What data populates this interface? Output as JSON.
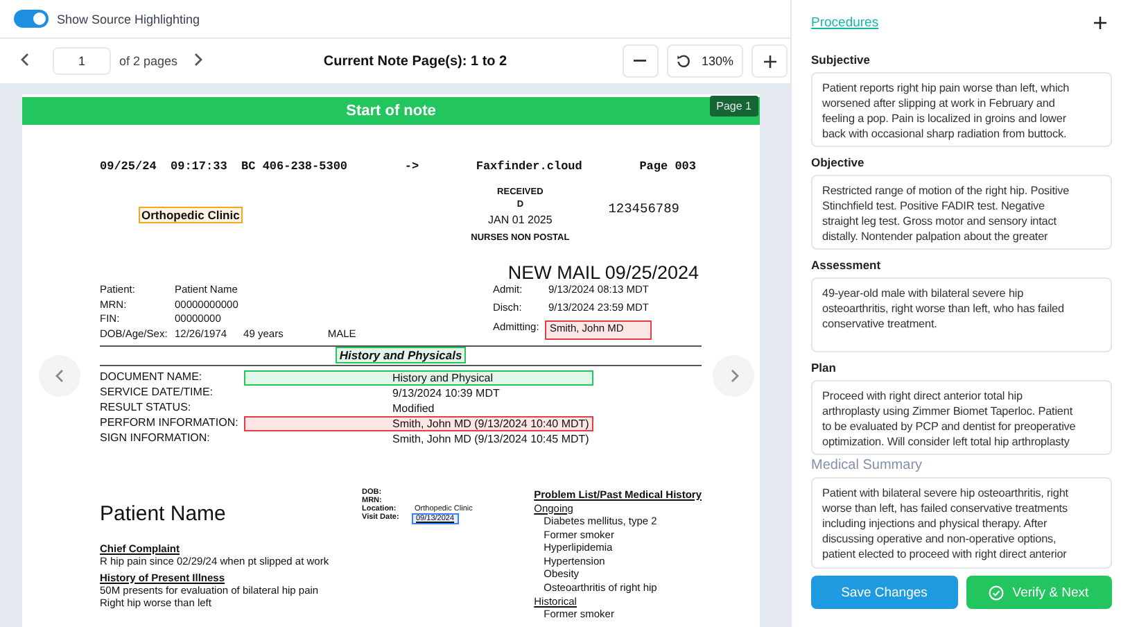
{
  "highlight_toggle": {
    "label": "Show Source Highlighting",
    "on": true
  },
  "toolbar": {
    "page_input": "1",
    "page_count": "of 2 pages",
    "title": "Current Note Page(s): 1 to 2",
    "zoom": "130%"
  },
  "document": {
    "banner": "Start of note",
    "page_badge": "Page 1",
    "fax_header": [
      "09/25/24  09:17:33  BC 406-238-5300",
      "->",
      "Faxfinder.cloud",
      "Page 003"
    ],
    "clinic": {
      "text": "Orthopedic Clinic",
      "color": "#f5a623"
    },
    "stamp": [
      "RECEIVED",
      "D",
      "JAN 01 2025",
      "NURSES NON POSTAL"
    ],
    "stamp_number": "123456789",
    "mail_title": "NEW MAIL 09/25/2024",
    "patient_fields": [
      {
        "label": "Patient:",
        "values": [
          "Patient Name"
        ]
      },
      {
        "label": "MRN:",
        "values": [
          "00000000000"
        ]
      },
      {
        "label": "FIN:",
        "values": [
          "00000000"
        ]
      },
      {
        "label": "DOB/Age/Sex:",
        "values": [
          "12/26/1974",
          "49 years",
          "MALE"
        ]
      }
    ],
    "admission_fields": [
      {
        "label": "Admit:",
        "value": "9/13/2024 08:13 MDT"
      },
      {
        "label": "Disch:",
        "value": "9/13/2024 23:59 MDT"
      },
      {
        "label": "Admitting:",
        "value": "Smith, John MD",
        "color": "#e53e3e"
      }
    ],
    "section_title": {
      "text": "History and Physicals",
      "color": "#22c55e"
    },
    "document_fields": [
      {
        "label": "DOCUMENT NAME:",
        "value": "History and Physical",
        "color": "#22c55e"
      },
      {
        "label": "SERVICE DATE/TIME:",
        "value": "9/13/2024 10:39 MDT"
      },
      {
        "label": "RESULT STATUS:",
        "value": "Modified"
      },
      {
        "label": "PERFORM INFORMATION:",
        "value": "Smith, John MD (9/13/2024 10:40 MDT)",
        "color": "#e53e3e"
      },
      {
        "label": "SIGN INFORMATION:",
        "value": "Smith, John MD (9/13/2024 10:45 MDT)"
      }
    ],
    "patient_name": "Patient Name",
    "visit_fields": [
      {
        "label": "DOB:"
      },
      {
        "label": "MRN:"
      },
      {
        "label": "Location:",
        "value": "Orthopedic Clinic"
      },
      {
        "label": "Visit Date:",
        "value": "09/13/2024",
        "color": "#3b82f6"
      }
    ],
    "note_sections": [
      {
        "heading": "Chief Complaint",
        "lines": [
          "R hip pain since 02/29/24 when pt slipped at work"
        ]
      },
      {
        "heading": "History of Present Illness",
        "lines": [
          "50M presents for evaluation of bilateral hip pain",
          "Right hip worse than left"
        ]
      }
    ],
    "problem_list": {
      "heading": "Problem List/Past Medical History",
      "groups": [
        {
          "label": "Ongoing",
          "items": [
            "Diabetes mellitus, type 2",
            "Former smoker",
            "Hyperlipidemia",
            "Hypertension",
            "Obesity",
            "Osteoarthritis of right hip"
          ]
        },
        {
          "label": "Historical",
          "items": [
            "Former smoker"
          ]
        }
      ]
    }
  },
  "panel": {
    "link": "Procedures",
    "sections": [
      {
        "kind": "soap",
        "label": "Subjective",
        "lines": [
          "Patient reports right hip pain worse than left, which",
          "worsened after slipping at work in February and",
          "feeling a pop. Pain is localized in groins and lower",
          "back with occasional sharp radiation from buttock."
        ]
      },
      {
        "kind": "soap",
        "label": "Objective",
        "lines": [
          "Restricted range of motion of the right hip. Positive",
          "Stinchfield test. Positive FADIR test. Negative",
          "straight leg test. Gross motor and sensory intact",
          "distally. Nontender palpation about the greater"
        ]
      },
      {
        "kind": "soap",
        "label": "Assessment",
        "lines": [
          "49-year-old male with bilateral severe hip",
          "osteoarthritis, right worse than left, who has failed",
          "conservative treatment."
        ]
      },
      {
        "kind": "soap",
        "label": "Plan",
        "lines": [
          "Proceed with right direct anterior total hip",
          "arthroplasty using Zimmer Biomet Taperloc. Patient",
          "to be evaluated by PCP and dentist for preoperative",
          "optimization. Will consider left total hip arthroplasty"
        ]
      },
      {
        "kind": "summary",
        "label": "Medical Summary",
        "lines": [
          "Patient with bilateral severe hip osteoarthritis, right",
          "worse than left, has failed conservative treatments",
          "including injections and physical therapy. After",
          "discussing operative and non-operative options,",
          "patient elected to proceed with right direct anterior"
        ]
      }
    ],
    "buttons": [
      {
        "kind": "save",
        "label": "Save Changes"
      },
      {
        "kind": "verify",
        "label": "Verify & Next"
      }
    ]
  }
}
